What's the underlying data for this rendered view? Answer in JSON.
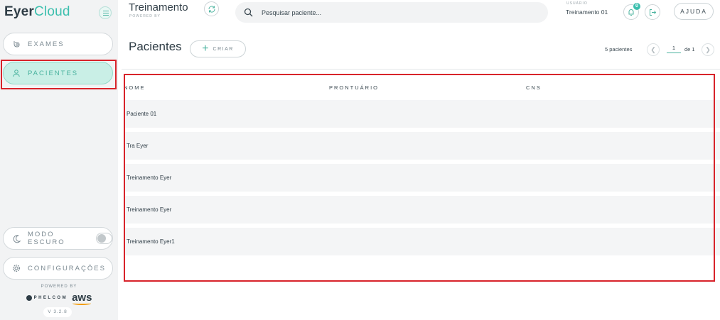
{
  "app": {
    "logo_main": "Eyer",
    "logo_accent": "Cloud"
  },
  "sidebar": {
    "items": [
      {
        "label": "EXAMES",
        "icon": "eye-drop-icon"
      },
      {
        "label": "PACIENTES",
        "icon": "person-icon",
        "active": true
      }
    ],
    "dark_mode_label": "MODO ESCURO",
    "settings_label": "CONFIGURAÇÕES",
    "powered_by": "POWERED BY",
    "partner_phelcom": "PHELCOM",
    "partner_aws": "aws",
    "version": "V 3.2.8"
  },
  "header": {
    "clinic_name": "Treinamento",
    "powered_by": "POWERED BY",
    "search_placeholder": "Pesquisar paciente...",
    "user_label": "USUÁRIO",
    "user_name": "Treinamento 01",
    "notification_count": "0",
    "help_label": "AJUDA"
  },
  "main": {
    "title": "Pacientes",
    "create_label": "CRIAR",
    "count_text": "5 pacientes",
    "page_number": "1",
    "page_of": "de 1",
    "columns": [
      "NOME",
      "PRONTUÁRIO",
      "CNS"
    ],
    "rows": [
      {
        "nome": "Paciente 01",
        "prontuario": "",
        "cns": ""
      },
      {
        "nome": "Tra Eyer",
        "prontuario": "",
        "cns": ""
      },
      {
        "nome": "Treinamento Eyer",
        "prontuario": "",
        "cns": ""
      },
      {
        "nome": "Treinamento Eyer",
        "prontuario": "",
        "cns": ""
      },
      {
        "nome": "Treinamento Eyer1",
        "prontuario": "",
        "cns": ""
      }
    ]
  },
  "colors": {
    "accent": "#3cbfae",
    "highlight": "#d8232a",
    "active_bg": "#c9efe6"
  }
}
